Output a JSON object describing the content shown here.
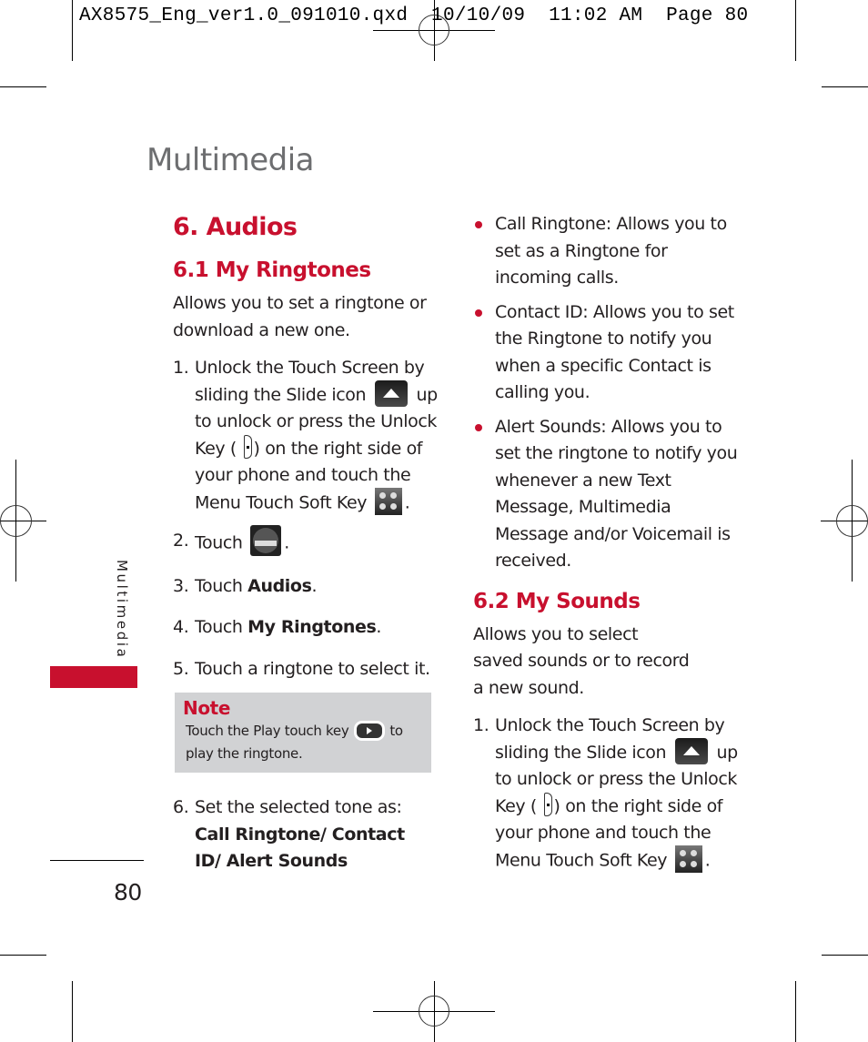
{
  "slug": "AX8575_Eng_ver1.0_091010.qxd  10/10/09  11:02 AM  Page 80",
  "chapter_title": "Multimedia",
  "side_tab_label": "Multimedia",
  "page_number": "80",
  "accent_color": "#c8102e",
  "left_column": {
    "section_title": "6. Audios",
    "subsection_title": "6.1 My Ringtones",
    "intro": "Allows you to set a ringtone or download a new one.",
    "steps": [
      {
        "num": "1.",
        "parts": {
          "a": "Unlock the Touch Screen by sliding the Slide icon",
          "b": "up to unlock or press the Unlock Key (",
          "c": ") on the right side of your phone and touch the Menu Touch Soft Key",
          "d": "."
        },
        "icons": [
          "slide-up-icon",
          "unlock-key-icon",
          "menu-soft-key-icon"
        ]
      },
      {
        "num": "2.",
        "text": "Touch",
        "end": ".",
        "icon": "multimedia-icon"
      },
      {
        "num": "3.",
        "text": "Touch ",
        "bold": "Audios",
        "end": "."
      },
      {
        "num": "4.",
        "text": "Touch ",
        "bold": "My Ringtones",
        "end": "."
      },
      {
        "num": "5.",
        "text": "Touch a ringtone to select it."
      }
    ],
    "note": {
      "title": "Note",
      "text_before": "Touch the Play touch key",
      "text_after": "to play the ringtone.",
      "icon": "play-key-icon"
    },
    "step6": {
      "num": "6.",
      "text": "Set the selected tone as:",
      "bold": "Call Ringtone/ Contact ID/ Alert Sounds"
    }
  },
  "right_column": {
    "bullets": [
      "Call Ringtone: Allows you to set as a Ringtone for incoming calls.",
      "Contact ID: Allows you to set the Ringtone to notify you when a specific Contact is calling you.",
      "Alert Sounds: Allows you to set the ringtone to notify you whenever a new Text Message, Multimedia Message and/or Voicemail is received."
    ],
    "subsection_title": "6.2 My Sounds",
    "intro": "Allows you to select saved sounds or to record a new sound.",
    "step1": {
      "num": "1.",
      "a": "Unlock the Touch Screen by sliding the Slide icon",
      "b": "up to unlock or press the Unlock Key (",
      "c": ") on the right side of your phone and touch the Menu Touch Soft Key",
      "d": "."
    }
  }
}
